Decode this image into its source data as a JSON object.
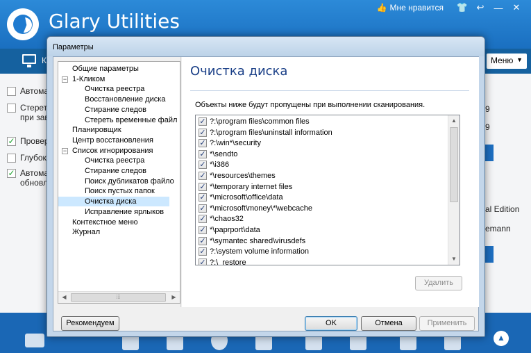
{
  "app": {
    "title": "Glary Utilities",
    "like_label": "Мне нравится",
    "nav_peek": "К",
    "menu_label": "Меню"
  },
  "background": {
    "rows": [
      {
        "text": "Автома",
        "checked": false
      },
      {
        "text": "Стерет",
        "text2": "при зав",
        "checked": false
      },
      {
        "text": "Провер",
        "checked": true
      },
      {
        "text": "Глубок",
        "checked": false
      },
      {
        "text": "Автома",
        "text2": "обновл",
        "checked": true
      }
    ],
    "right_peek": [
      "9",
      "9",
      "al Edition",
      "emann"
    ]
  },
  "dialog": {
    "title": "Параметры",
    "tree": [
      {
        "label": "Общие параметры",
        "level": 0
      },
      {
        "label": "1-Кликом",
        "level": 0,
        "expander": "−"
      },
      {
        "label": "Очистка реестра",
        "level": 1
      },
      {
        "label": "Восстановление диска",
        "level": 1
      },
      {
        "label": "Стирание следов",
        "level": 1
      },
      {
        "label": "Стереть временные файл",
        "level": 1
      },
      {
        "label": "Планировщик",
        "level": 0
      },
      {
        "label": "Центр восстановления",
        "level": 0
      },
      {
        "label": "Список игнорирования",
        "level": 0,
        "expander": "−"
      },
      {
        "label": "Очистка реестра",
        "level": 1
      },
      {
        "label": "Стирание следов",
        "level": 1
      },
      {
        "label": "Поиск дубликатов файло",
        "level": 1
      },
      {
        "label": "Поиск пустых папок",
        "level": 1
      },
      {
        "label": "Очистка диска",
        "level": 1,
        "selected": true
      },
      {
        "label": "Исправление ярлыков",
        "level": 1
      },
      {
        "label": "Контекстное меню",
        "level": 0
      },
      {
        "label": "Журнал",
        "level": 0
      }
    ],
    "section_title": "Очистка диска",
    "info_text": "Объекты ниже будут пропущены при выполнении сканирования.",
    "ignore_list": [
      "?:\\program files\\common files",
      "?:\\program files\\uninstall information",
      "?:\\win*\\security",
      "*\\sendto",
      "*\\i386",
      "*\\resources\\themes",
      "*\\temporary internet files",
      "*\\microsoft\\office\\data",
      "*\\microsoft\\money\\*\\webcache",
      "*\\chaos32",
      "*\\paprport\\data",
      "*\\symantec shared\\virusdefs",
      "?:\\system volume information",
      "?:\\_restore"
    ],
    "check_mark": "✓",
    "buttons": {
      "delete": "Удалить",
      "recommended": "Рекомендуем",
      "ok": "OK",
      "cancel": "Отмена",
      "apply": "Применить"
    }
  }
}
